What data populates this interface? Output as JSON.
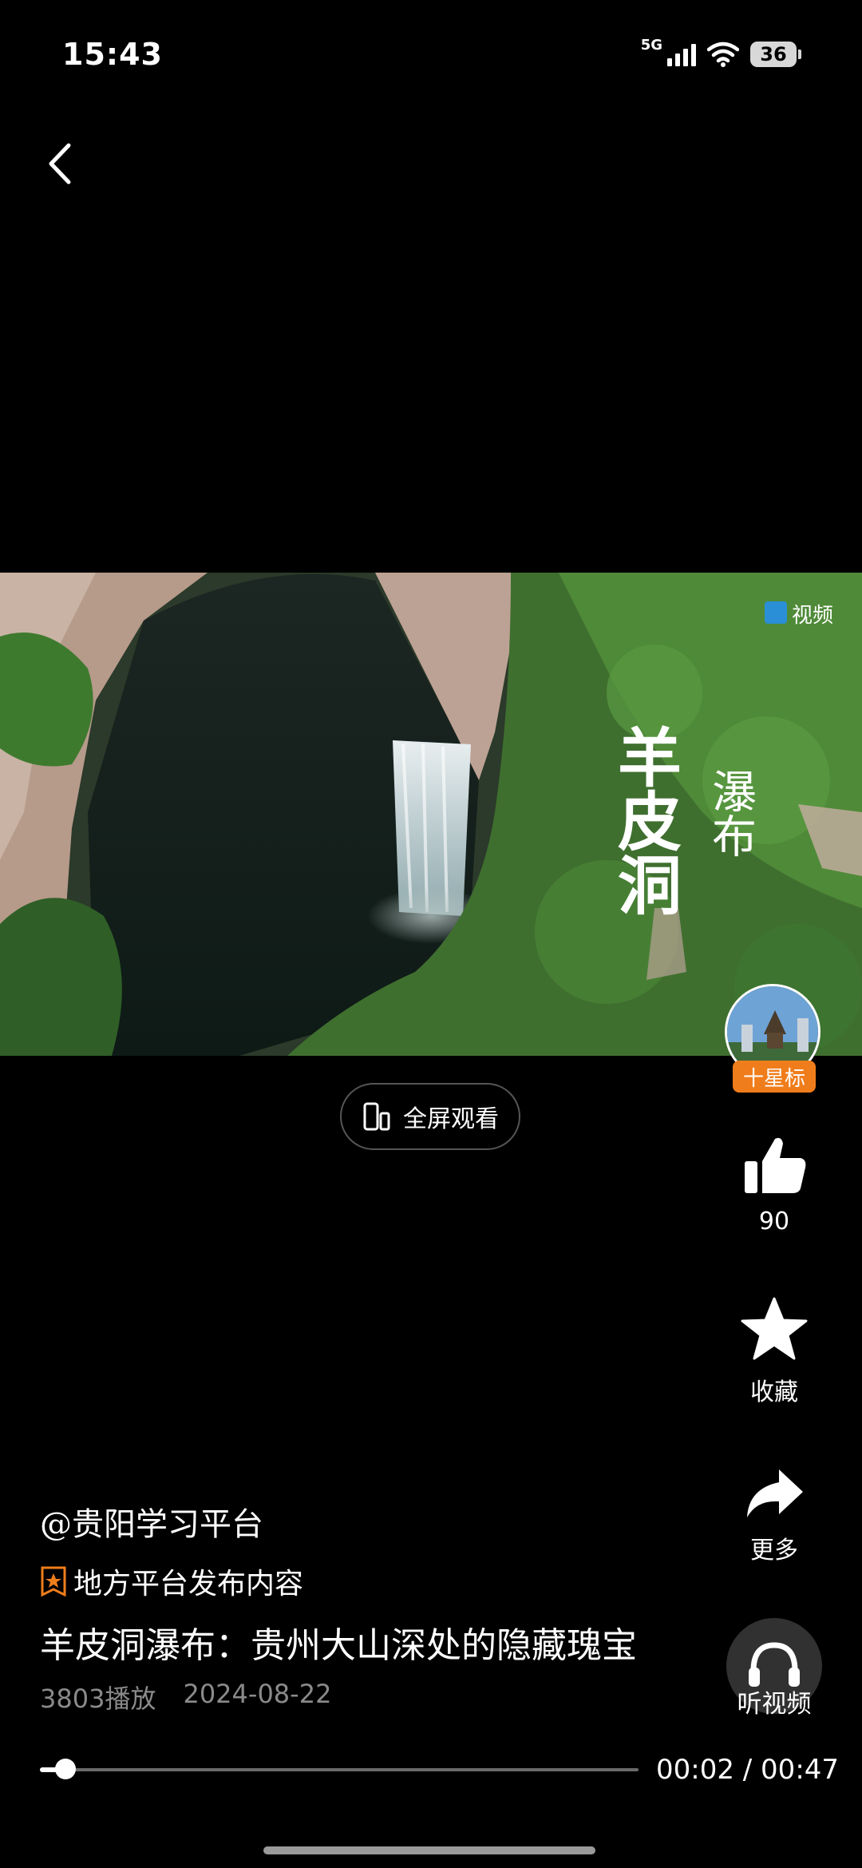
{
  "status": {
    "time": "15:43",
    "network": "5G",
    "battery": "36"
  },
  "video": {
    "watermark": "视频",
    "overlay_title_main": "羊皮洞",
    "overlay_title_sub": "瀑布"
  },
  "fullscreen_label": "全屏观看",
  "rail": {
    "follow_label": "十星标",
    "like_count": "90",
    "favorite_label": "收藏",
    "share_label": "更多",
    "listen_label": "听视频"
  },
  "post": {
    "author": "@贵阳学习平台",
    "source_note": "地方平台发布内容",
    "title": "羊皮洞瀑布：贵州大山深处的隐藏瑰宝",
    "plays": "3803播放",
    "date": "2024-08-22"
  },
  "player": {
    "current": "00:02",
    "duration": "00:47",
    "time_text": "00:02 / 00:47",
    "progress": 0.042
  },
  "colors": {
    "accent_orange": "#f07d1b",
    "background": "#000000"
  },
  "icons": [
    "back-icon",
    "signal-icon",
    "wifi-icon",
    "battery-icon",
    "fullscreen-phone-icon",
    "thumbs-up-icon",
    "star-icon",
    "share-arrow-icon",
    "headphones-icon",
    "source-star-icon"
  ]
}
